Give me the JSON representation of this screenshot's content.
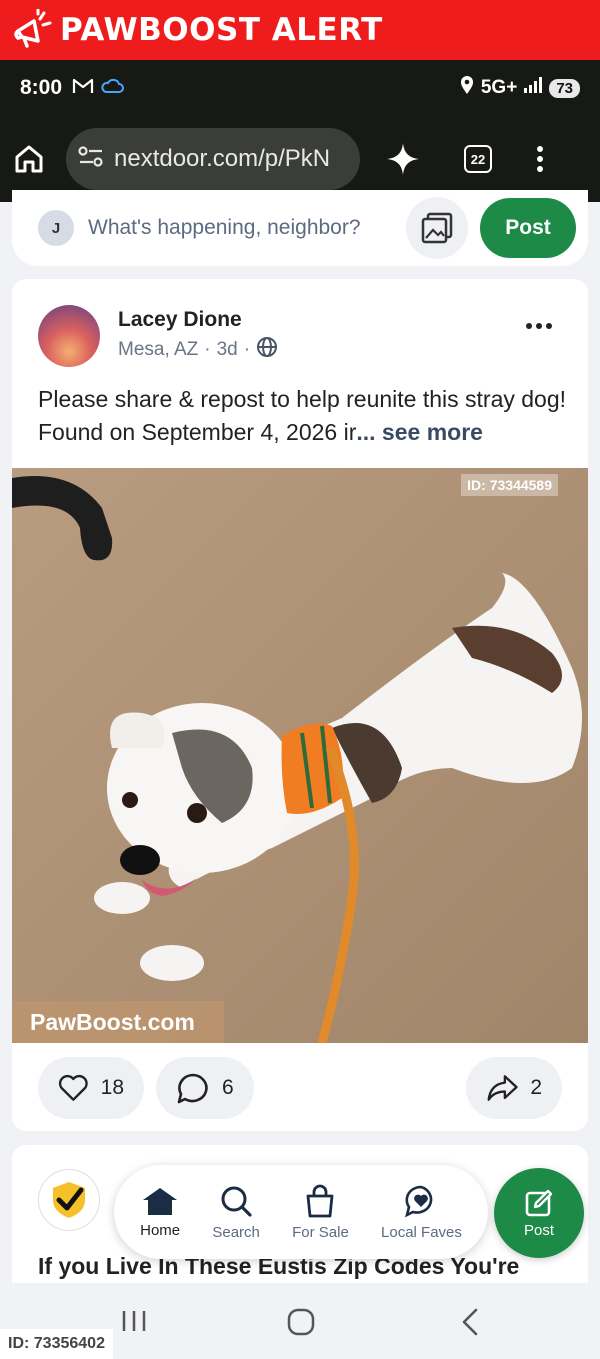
{
  "banner": {
    "title": "PAWBOOST ALERT",
    "icon": "megaphone-icon"
  },
  "status_bar": {
    "time": "8:00",
    "network": "5G+",
    "battery": "73"
  },
  "browser": {
    "url": "nextdoor.com/p/PkN",
    "tab_count": "22"
  },
  "composer": {
    "avatar_initial": "J",
    "placeholder": "What's happening, neighbor?",
    "post_label": "Post"
  },
  "post": {
    "author": "Lacey Dione",
    "location": "Mesa, AZ",
    "age": "3d",
    "text": "Please share & repost to help reunite this stray dog! Found on September 4, 2026 ir",
    "see_more": "... see more",
    "photo_id": "ID: 73344589",
    "watermark": "PawBoost.com",
    "likes": "18",
    "comments": "6",
    "shares": "2"
  },
  "second_post": {
    "title": "If you Live In These Eustis Zip Codes You're"
  },
  "bottom_nav": {
    "items": [
      {
        "label": "Home",
        "icon": "home-icon"
      },
      {
        "label": "Search",
        "icon": "search-icon"
      },
      {
        "label": "For Sale",
        "icon": "shopping-bag-icon"
      },
      {
        "label": "Local Faves",
        "icon": "heart-chat-icon"
      }
    ],
    "fab_label": "Post"
  },
  "footer_id": "ID: 73356402",
  "colors": {
    "banner_red": "#ee1c1c",
    "brand_green": "#1d8a48",
    "dark_bar": "#171a14"
  }
}
